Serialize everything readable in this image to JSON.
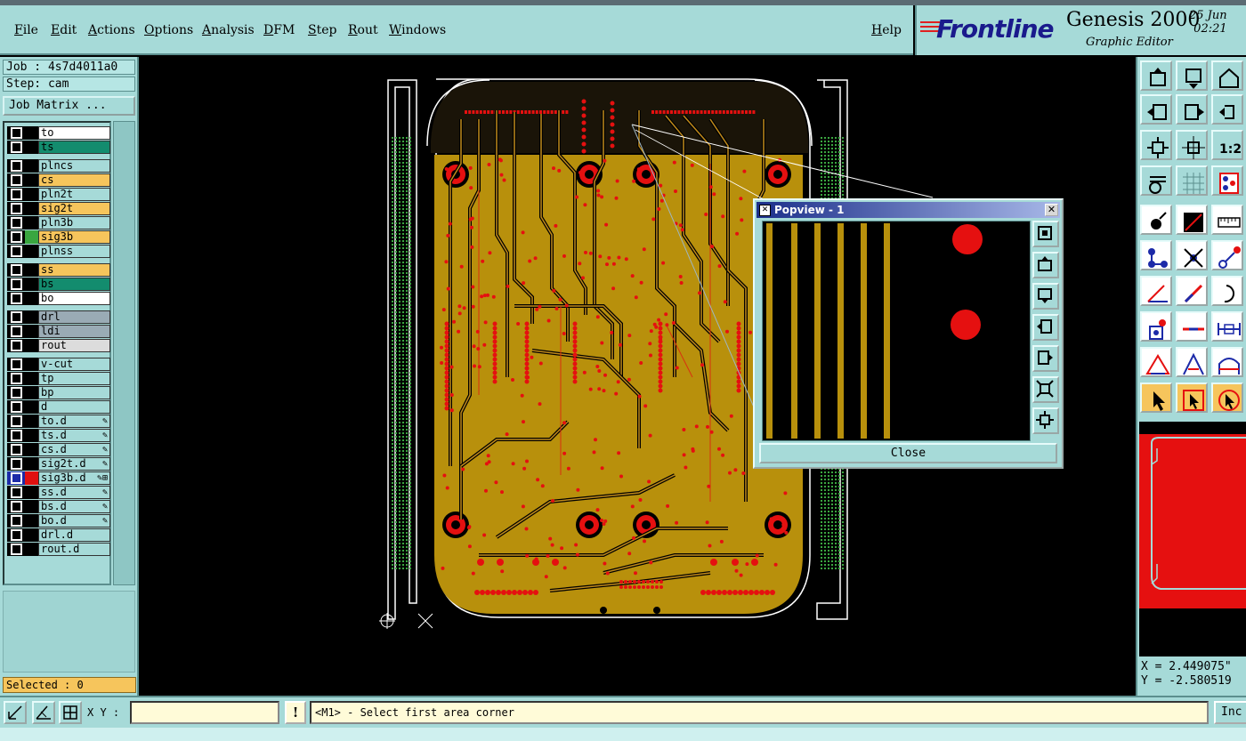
{
  "menu": {
    "items": [
      "File",
      "Edit",
      "Actions",
      "Options",
      "Analysis",
      "DFM",
      "Step",
      "Rout",
      "Windows"
    ],
    "help": "Help"
  },
  "brand": {
    "logo": "Frontline",
    "product": "Genesis 2000",
    "subtitle": "Graphic Editor",
    "date": "25 Jun",
    "time": "02:21"
  },
  "job": {
    "job_label": "Job : 4s7d4011a0",
    "step_label": "Step: cam",
    "matrix_button": "Job Matrix ..."
  },
  "layers": [
    {
      "name": "to",
      "color": "#ffffff",
      "group": 0
    },
    {
      "name": "ts",
      "color": "#138c6e",
      "group": 0
    },
    {
      "name": "plncs",
      "color": "#a6dad8",
      "group": 1
    },
    {
      "name": "cs",
      "color": "#f6c55c",
      "group": 1
    },
    {
      "name": "pln2t",
      "color": "#a6dad8",
      "group": 1
    },
    {
      "name": "sig2t",
      "color": "#f6c55c",
      "group": 1
    },
    {
      "name": "pln3b",
      "color": "#a6dad8",
      "group": 1
    },
    {
      "name": "sig3b",
      "color": "#f6c55c",
      "group": 1,
      "swatch": "#3aa640"
    },
    {
      "name": "plnss",
      "color": "#a6dad8",
      "group": 1
    },
    {
      "name": "ss",
      "color": "#f6c55c",
      "group": 2
    },
    {
      "name": "bs",
      "color": "#138c6e",
      "group": 2
    },
    {
      "name": "bo",
      "color": "#ffffff",
      "group": 2
    },
    {
      "name": "drl",
      "color": "#9aabb5",
      "group": 3
    },
    {
      "name": "ldi",
      "color": "#9aabb5",
      "group": 3
    },
    {
      "name": "rout",
      "color": "#dcdcdc",
      "group": 3
    },
    {
      "name": "v-cut",
      "color": "#a6dad8",
      "group": 4
    },
    {
      "name": "tp",
      "color": "#a6dad8",
      "group": 4
    },
    {
      "name": "bp",
      "color": "#a6dad8",
      "group": 4
    },
    {
      "name": "d",
      "color": "#a6dad8",
      "group": 4
    },
    {
      "name": "to.d",
      "color": "#a6dad8",
      "group": 4,
      "pen": "✎"
    },
    {
      "name": "ts.d",
      "color": "#a6dad8",
      "group": 4,
      "pen": "✎"
    },
    {
      "name": "cs.d",
      "color": "#a6dad8",
      "group": 4,
      "pen": "✎"
    },
    {
      "name": "sig2t.d",
      "color": "#a6dad8",
      "group": 4,
      "pen": "✎"
    },
    {
      "name": "sig3b.d",
      "color": "#a6dad8",
      "group": 4,
      "pen": "✎⊞",
      "active": true,
      "swatch": "#e01010"
    },
    {
      "name": "ss.d",
      "color": "#a6dad8",
      "group": 4,
      "pen": "✎"
    },
    {
      "name": "bs.d",
      "color": "#a6dad8",
      "group": 4,
      "pen": "✎"
    },
    {
      "name": "bo.d",
      "color": "#a6dad8",
      "group": 4,
      "pen": "✎"
    },
    {
      "name": "drl.d",
      "color": "#a6dad8",
      "group": 4
    },
    {
      "name": "rout.d",
      "color": "#a6dad8",
      "group": 4
    }
  ],
  "selected": "Selected : 0",
  "popview": {
    "title": "Popview - 1",
    "close_label": "Close"
  },
  "coords": {
    "x": "X = 2.449075\"",
    "y": "Y = -2.580519"
  },
  "bottom": {
    "xy_label": "X Y :",
    "xy_value": "",
    "warn": "!",
    "status": "<M1> - Select first area corner",
    "inc": "Inc"
  },
  "colors": {
    "panel": "#a6dad8",
    "copper": "#b8900c",
    "pad": "#e51010",
    "highlight": "#f6c55c"
  }
}
